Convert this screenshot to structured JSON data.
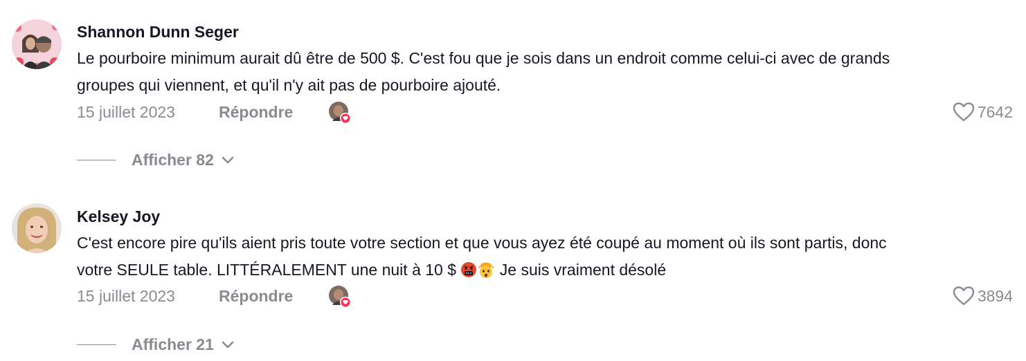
{
  "comments": [
    {
      "username": "Shannon Dunn Seger",
      "text_lines": [
        "Le pourboire minimum aurait dû être de 500 $. C'est fou que je sois dans un endroit comme celui-ci avec de grands",
        "groupes qui viennent, et qu'il n'y ait pas de pourboire ajouté."
      ],
      "date": "15 juillet 2023",
      "reply_label": "Répondre",
      "likes": "7642",
      "view_replies_label": "Afficher 82"
    },
    {
      "username": "Kelsey Joy",
      "text_lines": [
        "C'est encore pire qu'ils aient pris toute votre section et que vous ayez été coupé au moment où ils sont partis, donc",
        "votre SEULE table. LITTÉRALEMENT une nuit à 10 $"
      ],
      "text_tail": "Je suis vraiment désolé",
      "emojis": [
        "face-with-symbols-on-mouth",
        "exploding-head"
      ],
      "date": "15 juillet 2023",
      "reply_label": "Répondre",
      "likes": "3894",
      "view_replies_label": "Afficher 21"
    }
  ],
  "icons": {
    "like": "heart-outline-icon",
    "creator_like": "creator-liked-badge",
    "expand": "chevron-down-icon"
  },
  "colors": {
    "text": "#161823",
    "muted": "#8a8b91",
    "heart_badge": "#fe2c55"
  }
}
